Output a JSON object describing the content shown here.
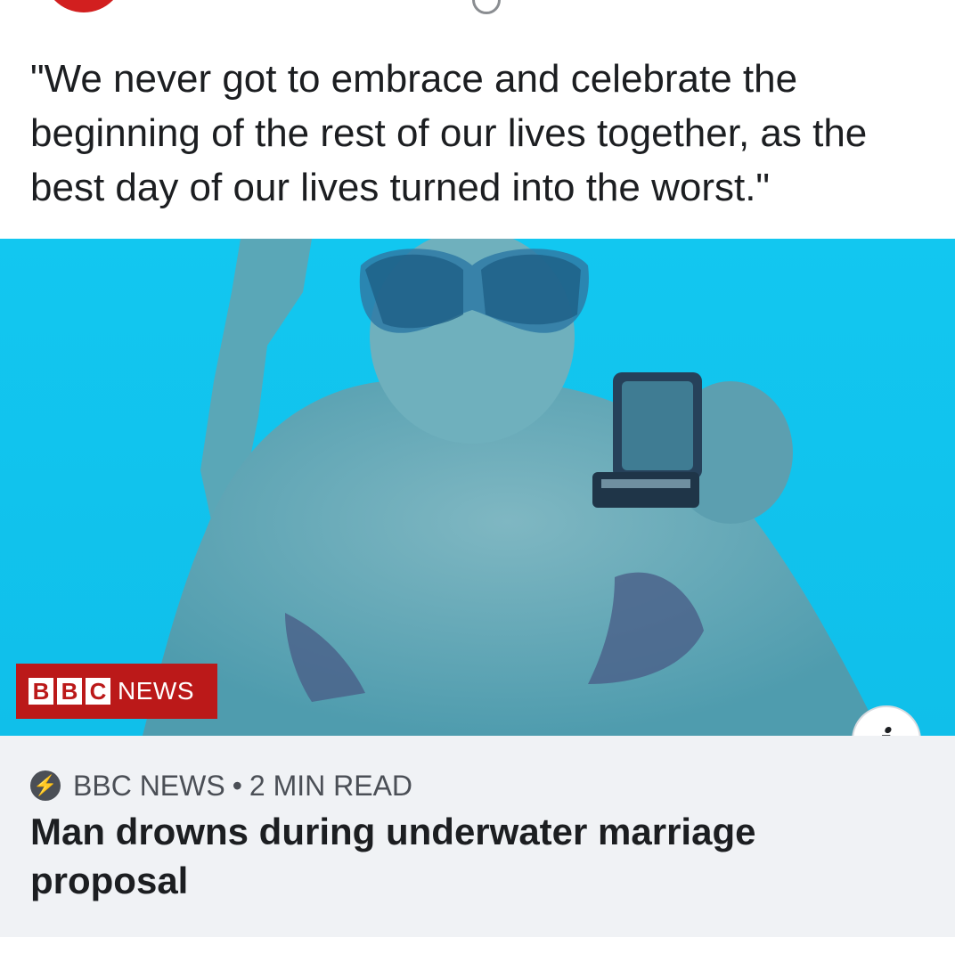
{
  "post": {
    "quote": "\"We never got to embrace and celebrate the beginning of the rest of our lives together, as the best day of our lives turned into the worst.\""
  },
  "media": {
    "badge": {
      "letters": [
        "B",
        "B",
        "C"
      ],
      "word": "NEWS"
    },
    "info_icon": "info-icon",
    "info_glyph": "i"
  },
  "link": {
    "source_icon": "lightning-bolt-icon",
    "source": "BBC NEWS",
    "separator": "•",
    "read_time": "2 MIN READ",
    "headline": "Man drowns during underwater marriage proposal"
  },
  "colors": {
    "bbc_red": "#bb1919",
    "water": "#0fc4ee",
    "card_bg": "#f0f2f5",
    "avatar_red": "#d21f1f"
  }
}
